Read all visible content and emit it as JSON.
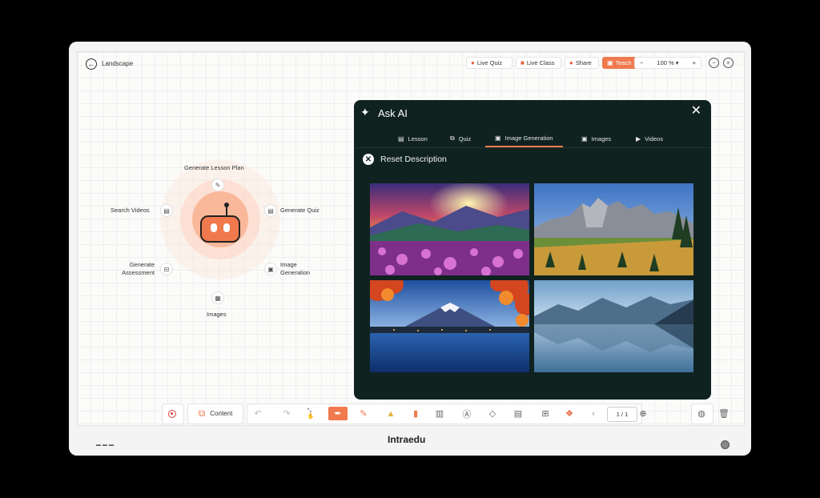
{
  "topbar": {
    "title": "Landscape",
    "buttons": {
      "live_quiz": "Live Quiz",
      "live_class": "Live Class",
      "share": "Share",
      "teach": "Teach"
    },
    "zoom": {
      "minus": "−",
      "value": "100 %",
      "plus": "+"
    }
  },
  "hub": {
    "generate_lesson_plan": "Generate Lesson Plan",
    "generate_quiz": "Generate Quiz",
    "search_videos": "Search Videos",
    "generate_assessment": "Generate Assessment",
    "image_generation": "Image Generation",
    "images": "Images"
  },
  "ask_ai": {
    "title": "Ask AI",
    "tabs": [
      "Lesson",
      "Quiz",
      "Image Generation",
      "Images",
      "Videos"
    ],
    "active_tab": "Image Generation",
    "reset_label": "Reset Description",
    "image_icons": [
      "sunset-valley-image",
      "mountain-peaks-image",
      "mount-fuji-autumn-image",
      "mountain-lake-reflection-image"
    ]
  },
  "toolbar": {
    "content_label": "Content",
    "page_indicator": "1 / 1"
  },
  "footer": {
    "brand": "Intraedu"
  },
  "colors": {
    "accent": "#f07a4e",
    "panel_bg": "#0f2220"
  }
}
